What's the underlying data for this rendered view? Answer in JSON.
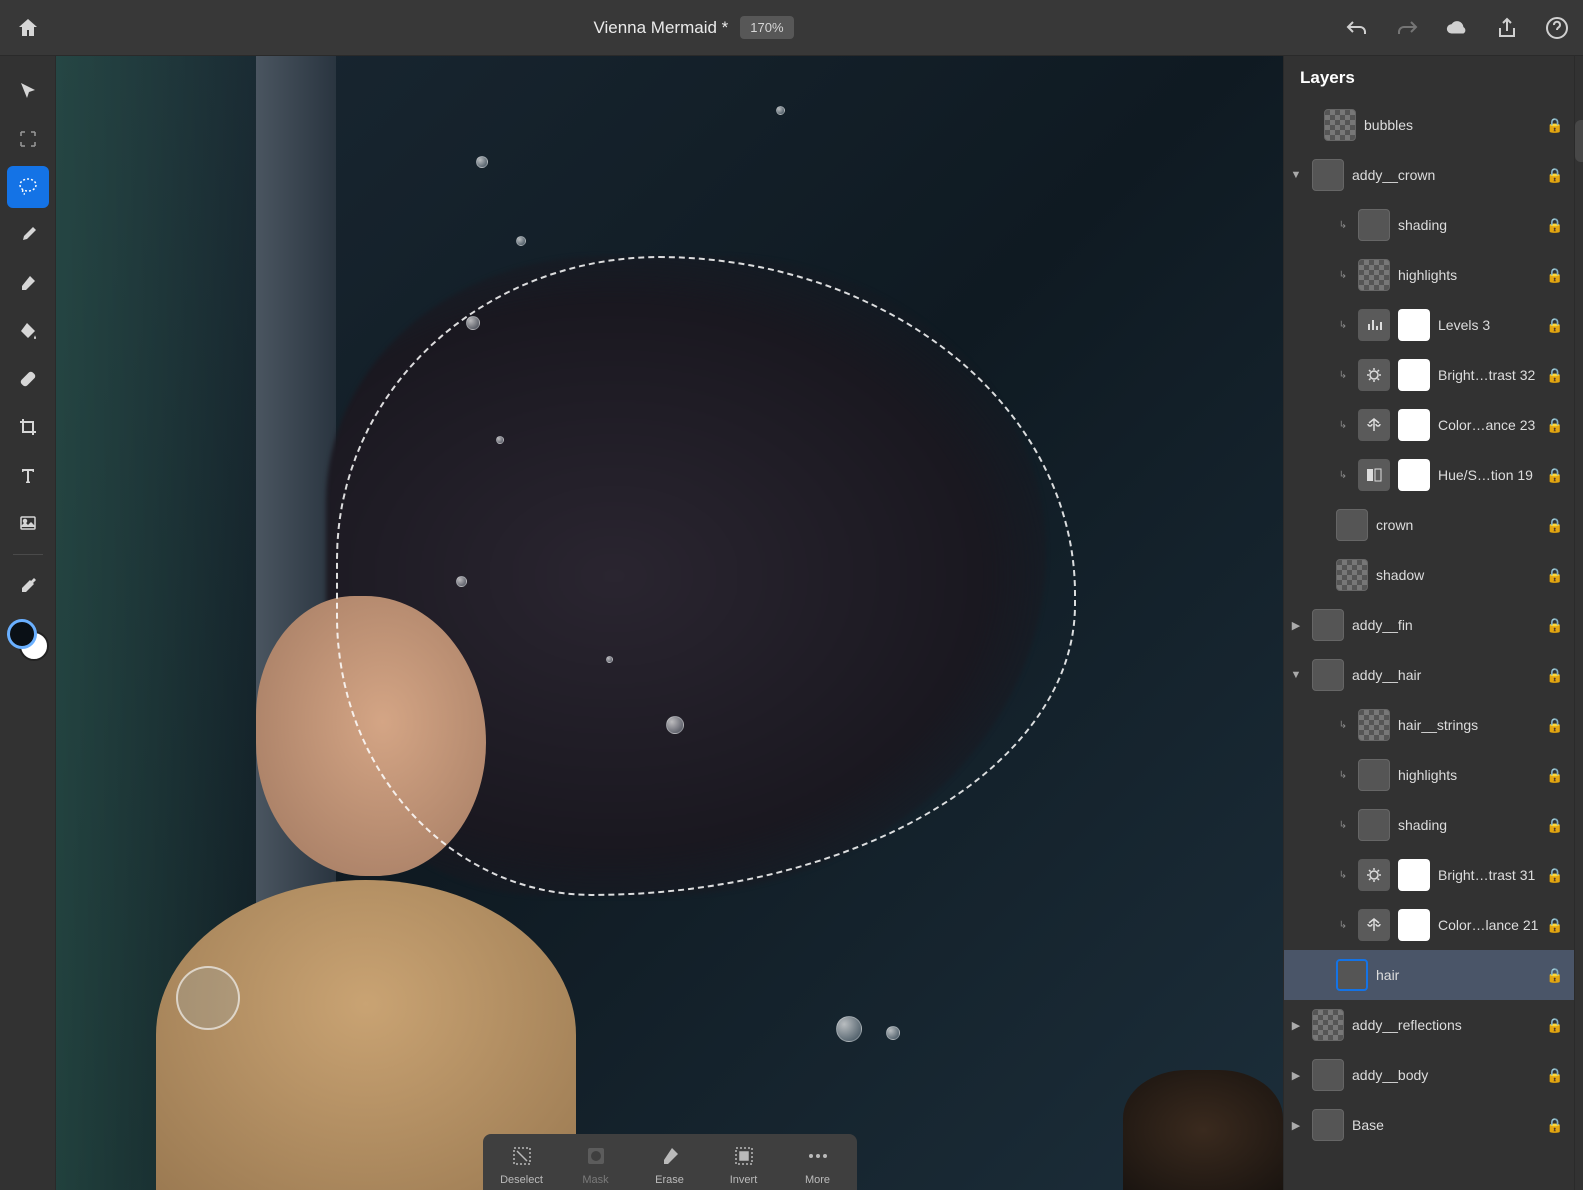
{
  "topbar": {
    "doc_title": "Vienna Mermaid *",
    "zoom": "170%"
  },
  "bottom_actions": {
    "deselect": "Deselect",
    "mask": "Mask",
    "erase": "Erase",
    "invert": "Invert",
    "more": "More"
  },
  "panels": {
    "layers_title": "Layers"
  },
  "layers": [
    {
      "name": "bubbles",
      "nest": 1
    },
    {
      "name": "addy__crown",
      "nest": 0,
      "expanded": true
    },
    {
      "name": "shading",
      "nest": 2,
      "clip": true
    },
    {
      "name": "highlights",
      "nest": 2,
      "clip": true
    },
    {
      "name": "Levels 3",
      "nest": 2,
      "clip": true,
      "adj": "levels"
    },
    {
      "name": "Bright…trast 32",
      "nest": 2,
      "clip": true,
      "adj": "bright"
    },
    {
      "name": "Color…ance 23",
      "nest": 2,
      "clip": true,
      "adj": "balance"
    },
    {
      "name": "Hue/S…tion 19",
      "nest": 2,
      "clip": true,
      "adj": "hue"
    },
    {
      "name": "crown",
      "nest": 2
    },
    {
      "name": "shadow",
      "nest": 2
    },
    {
      "name": "addy__fin",
      "nest": 0,
      "collapsed": true
    },
    {
      "name": "addy__hair",
      "nest": 0,
      "expanded": true
    },
    {
      "name": "hair__strings",
      "nest": 2,
      "clip": true
    },
    {
      "name": "highlights",
      "nest": 2,
      "clip": true
    },
    {
      "name": "shading",
      "nest": 2,
      "clip": true
    },
    {
      "name": "Bright…trast 31",
      "nest": 2,
      "clip": true,
      "adj": "bright"
    },
    {
      "name": "Color…lance 21",
      "nest": 2,
      "clip": true,
      "adj": "balance"
    },
    {
      "name": "hair",
      "nest": 2,
      "selected": true
    },
    {
      "name": "addy__reflections",
      "nest": 0,
      "collapsed": true
    },
    {
      "name": "addy__body",
      "nest": 0,
      "collapsed": true
    },
    {
      "name": "Base",
      "nest": 0,
      "collapsed": true
    }
  ]
}
